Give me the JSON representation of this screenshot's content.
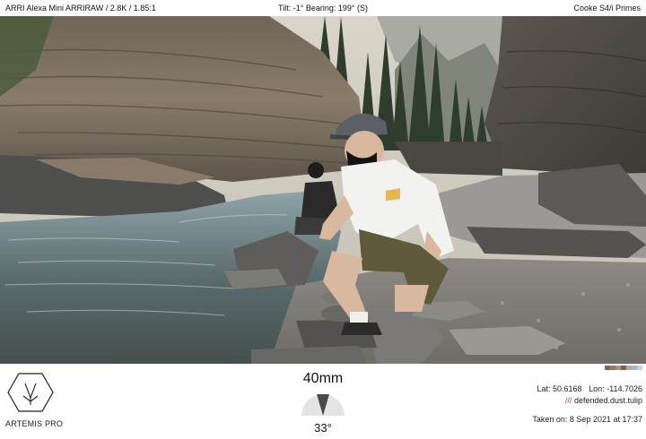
{
  "top_bar": {
    "camera": "ARRI Alexa Mini ARRIRAW / 2.8K / 1.85:1",
    "orientation": "Tilt: -1° Bearing: 199° (S)",
    "lens": "Cooke S4/i Primes"
  },
  "viewport": {
    "subject": "photo"
  },
  "color_palette": [
    "#7a6a5e",
    "#8c7b6d",
    "#a99584",
    "#6f655e",
    "#b8aa9c",
    "#a5b7c6",
    "#c7d2da"
  ],
  "bottom_bar": {
    "brand": "ARTEMIS PRO",
    "focal_length": "40mm",
    "tilt_angle": "33°",
    "coordinates_lat_label": "Lat:",
    "coordinates_lat": "50.6168",
    "coordinates_lon_label": "Lon:",
    "coordinates_lon": "-114.7026",
    "what3words_prefix": "///",
    "what3words": "defended.dust.tulip",
    "taken_on": "Taken on: 8 Sep 2021 at 17:37"
  }
}
